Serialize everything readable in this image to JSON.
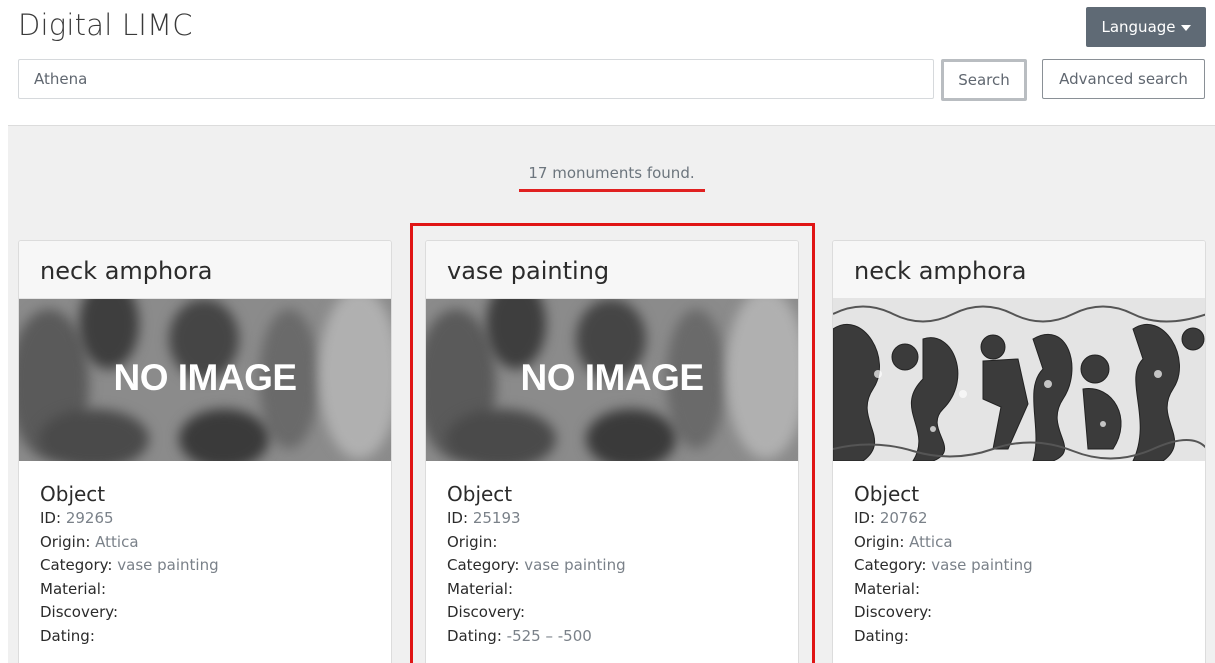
{
  "header": {
    "title": "Digital LIMC",
    "language_label": "Language"
  },
  "search": {
    "value": "Athena",
    "button_label": "Search",
    "advanced_label": "Advanced search"
  },
  "results": {
    "count_text": "17 monuments found.",
    "accent_color": "#e02020",
    "cards": [
      {
        "title": "neck amphora",
        "image": "NO IMAGE",
        "section": "Object",
        "fields": [
          {
            "label": "ID:",
            "value": "29265"
          },
          {
            "label": "Origin:",
            "value": "Attica"
          },
          {
            "label": "Category:",
            "value": "vase painting"
          },
          {
            "label": "Material:",
            "value": ""
          },
          {
            "label": "Discovery:",
            "value": ""
          },
          {
            "label": "Dating:",
            "value": ""
          }
        ]
      },
      {
        "title": "vase painting",
        "image": "NO IMAGE",
        "section": "Object",
        "fields": [
          {
            "label": "ID:",
            "value": "25193"
          },
          {
            "label": "Origin:",
            "value": ""
          },
          {
            "label": "Category:",
            "value": "vase painting"
          },
          {
            "label": "Material:",
            "value": ""
          },
          {
            "label": "Discovery:",
            "value": ""
          },
          {
            "label": "Dating:",
            "value": "-525 – -500"
          }
        ]
      },
      {
        "title": "neck amphora",
        "image": "",
        "section": "Object",
        "fields": [
          {
            "label": "ID:",
            "value": "20762"
          },
          {
            "label": "Origin:",
            "value": "Attica"
          },
          {
            "label": "Category:",
            "value": "vase painting"
          },
          {
            "label": "Material:",
            "value": ""
          },
          {
            "label": "Discovery:",
            "value": ""
          },
          {
            "label": "Dating:",
            "value": ""
          }
        ]
      }
    ]
  }
}
